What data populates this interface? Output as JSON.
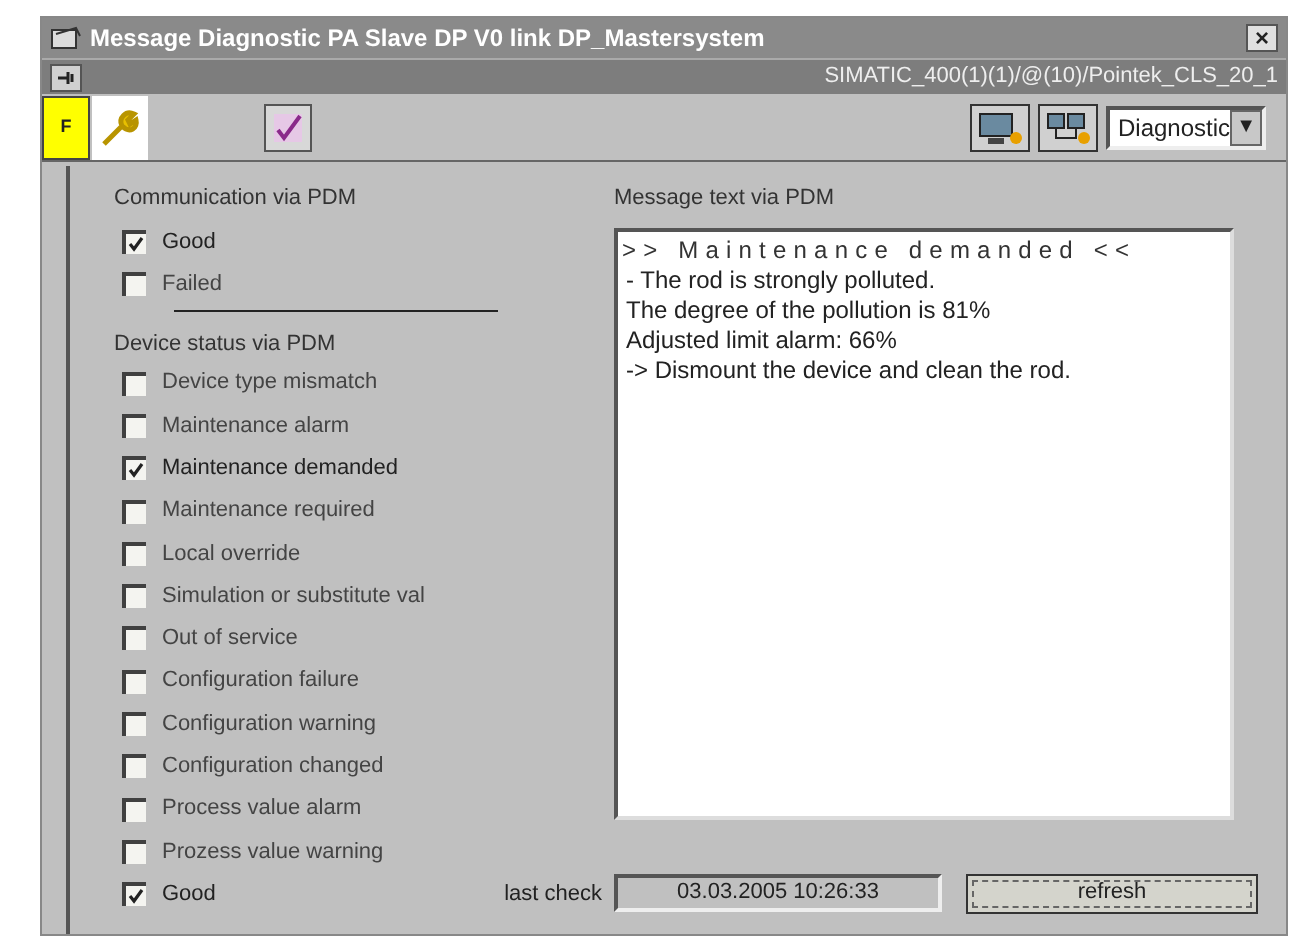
{
  "window": {
    "title": "Message Diagnostic PA Slave DP V0 link DP_Mastersystem",
    "close": "×"
  },
  "path_bar": {
    "path": "SIMATIC_400(1)(1)/@(10)/Pointek_CLS_20_1"
  },
  "toolbar": {
    "f_button": "F",
    "view_select": "Diagnostic",
    "dropdown_arrow": "▼"
  },
  "communication": {
    "title": "Communication via PDM",
    "items": [
      {
        "label": "Good",
        "checked": true
      },
      {
        "label": "Failed",
        "checked": false
      }
    ]
  },
  "device_status": {
    "title": "Device status via PDM",
    "items": [
      {
        "label": "Device type mismatch",
        "checked": false
      },
      {
        "label": "Maintenance alarm",
        "checked": false
      },
      {
        "label": "Maintenance demanded",
        "checked": true
      },
      {
        "label": "Maintenance required",
        "checked": false
      },
      {
        "label": "Local override",
        "checked": false
      },
      {
        "label": "Simulation or substitute val",
        "checked": false
      },
      {
        "label": "Out of service",
        "checked": false
      },
      {
        "label": "Configuration failure",
        "checked": false
      },
      {
        "label": "Configuration warning",
        "checked": false
      },
      {
        "label": "Configuration changed",
        "checked": false
      },
      {
        "label": "Process value alarm",
        "checked": false
      },
      {
        "label": "Prozess value warning",
        "checked": false
      },
      {
        "label": "Good",
        "checked": true
      }
    ]
  },
  "last_check": {
    "label": "last check",
    "value": "03.03.2005 10:26:33"
  },
  "message": {
    "title": "Message text via PDM",
    "lines": [
      {
        "kind": "heading",
        "text": ">> Maintenance demanded <<"
      },
      {
        "kind": "line",
        "text": "- The rod is strongly polluted."
      },
      {
        "kind": "line",
        "text": "The degree of the pollution is 81%"
      },
      {
        "kind": "line",
        "text": "Adjusted limit alarm: 66%"
      },
      {
        "kind": "line",
        "text": "-> Dismount the device and clean the rod."
      }
    ]
  },
  "refresh_button": "refresh"
}
